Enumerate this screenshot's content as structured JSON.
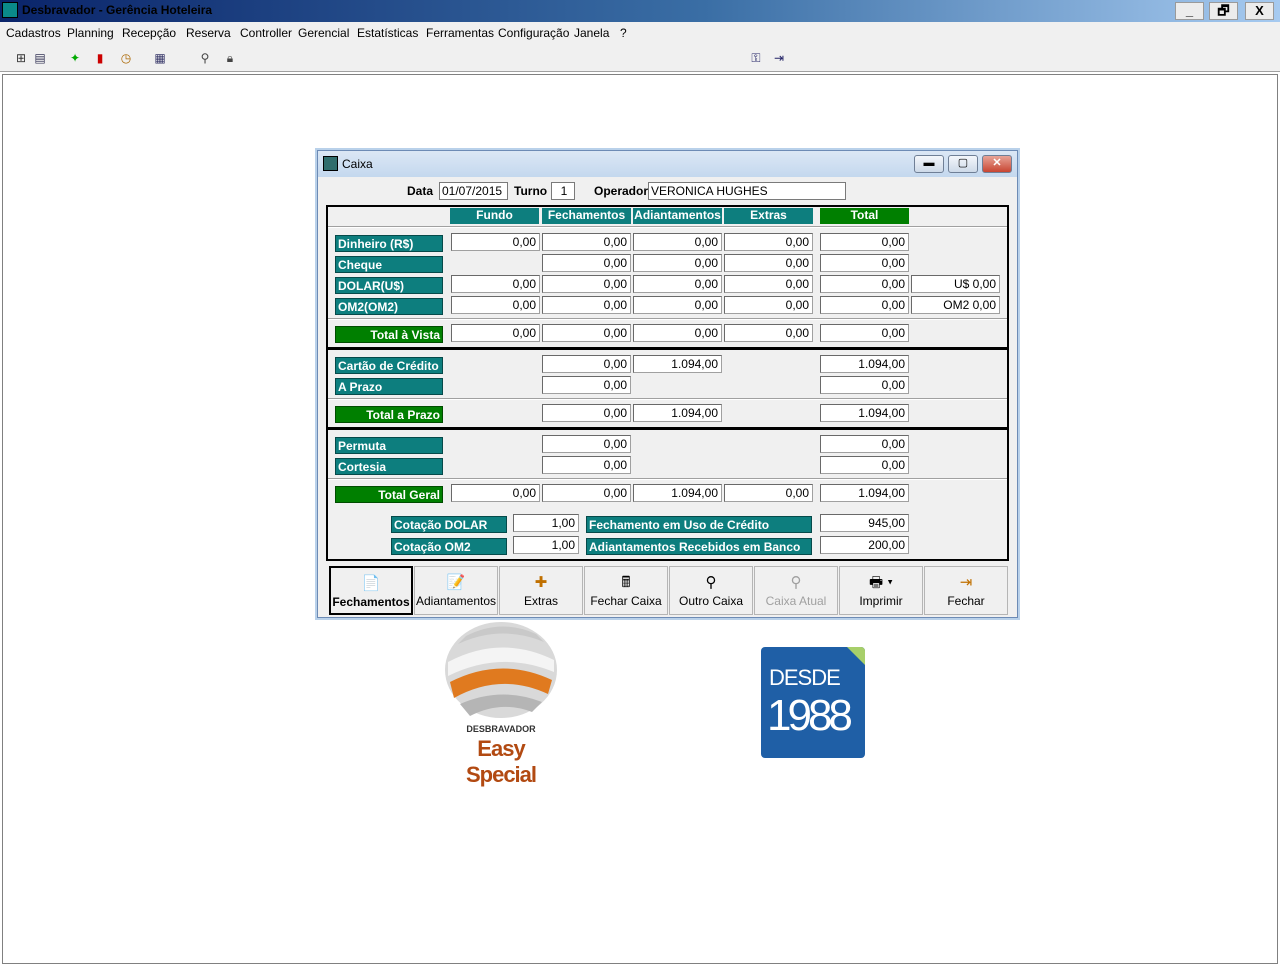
{
  "app": {
    "title": "Desbravador - Gerência Hoteleira"
  },
  "window_controls": {
    "minimize": "_",
    "restore": "🗗",
    "close": "X"
  },
  "menu": [
    "Cadastros",
    "Planning",
    "Recepção",
    "Reserva",
    "Controller",
    "Gerencial",
    "Estatísticas",
    "Ferramentas",
    "Configuração",
    "Janela",
    "?"
  ],
  "caixa": {
    "title": "Caixa",
    "header": {
      "data_label": "Data",
      "data_value": "01/07/2015",
      "turno_label": "Turno",
      "turno_value": "1",
      "operador_label": "Operador",
      "operador_value": "VERONICA HUGHES"
    },
    "columns": [
      "Fundo",
      "Fechamentos",
      "Adiantamentos",
      "Extras",
      "Total"
    ],
    "rows": {
      "dinheiro": {
        "label": "Dinheiro (R$)",
        "fundo": "0,00",
        "fech": "0,00",
        "adiant": "0,00",
        "extras": "0,00",
        "total": "0,00"
      },
      "cheque": {
        "label": "Cheque",
        "fech": "0,00",
        "adiant": "0,00",
        "extras": "0,00",
        "total": "0,00"
      },
      "dolar": {
        "label": "DOLAR(U$)",
        "fundo": "0,00",
        "fech": "0,00",
        "adiant": "0,00",
        "extras": "0,00",
        "total": "0,00",
        "moeda": "U$ 0,00"
      },
      "om2": {
        "label": "OM2(OM2)",
        "fundo": "0,00",
        "fech": "0,00",
        "adiant": "0,00",
        "extras": "0,00",
        "total": "0,00",
        "moeda": "OM2 0,00"
      },
      "total_vista": {
        "label": "Total à Vista",
        "fundo": "0,00",
        "fech": "0,00",
        "adiant": "0,00",
        "extras": "0,00",
        "total": "0,00"
      },
      "cartao": {
        "label": "Cartão de Crédito",
        "fech": "0,00",
        "adiant": "1.094,00",
        "total": "1.094,00"
      },
      "prazo": {
        "label": "A Prazo",
        "fech": "0,00",
        "total": "0,00"
      },
      "total_prazo": {
        "label": "Total a Prazo",
        "fech": "0,00",
        "adiant": "1.094,00",
        "total": "1.094,00"
      },
      "permuta": {
        "label": "Permuta",
        "fech": "0,00",
        "total": "0,00"
      },
      "cortesia": {
        "label": "Cortesia",
        "fech": "0,00",
        "total": "0,00"
      },
      "total_geral": {
        "label": "Total Geral",
        "fundo": "0,00",
        "fech": "0,00",
        "adiant": "1.094,00",
        "extras": "0,00",
        "total": "1.094,00"
      }
    },
    "cotacao": {
      "dolar_label": "Cotação DOLAR",
      "dolar_value": "1,00",
      "om2_label": "Cotação OM2",
      "om2_value": "1,00",
      "fech_credito_label": "Fechamento em Uso de Crédito",
      "fech_credito_value": "945,00",
      "adiant_banco_label": "Adiantamentos Recebidos em Banco",
      "adiant_banco_value": "200,00"
    },
    "buttons": [
      {
        "label": "Fechamentos",
        "icon": "📄"
      },
      {
        "label": "Adiantamentos",
        "icon": "📝"
      },
      {
        "label": "Extras",
        "icon": "✚"
      },
      {
        "label": "Fechar Caixa",
        "icon": "🖩"
      },
      {
        "label": "Outro Caixa",
        "icon": "⚲"
      },
      {
        "label": "Caixa Atual",
        "icon": "⚲"
      },
      {
        "label": "Imprimir",
        "icon": "🖶 ▾"
      },
      {
        "label": "Fechar",
        "icon": "⇥"
      }
    ]
  },
  "logos": {
    "brand_small": "DESBRAVADOR",
    "brand_big": "Easy Special",
    "desde": "DESDE",
    "year": "1988"
  },
  "colors": {
    "teal": "#0d7e7e",
    "green": "#007f00",
    "title_dark": "#0a246a"
  }
}
